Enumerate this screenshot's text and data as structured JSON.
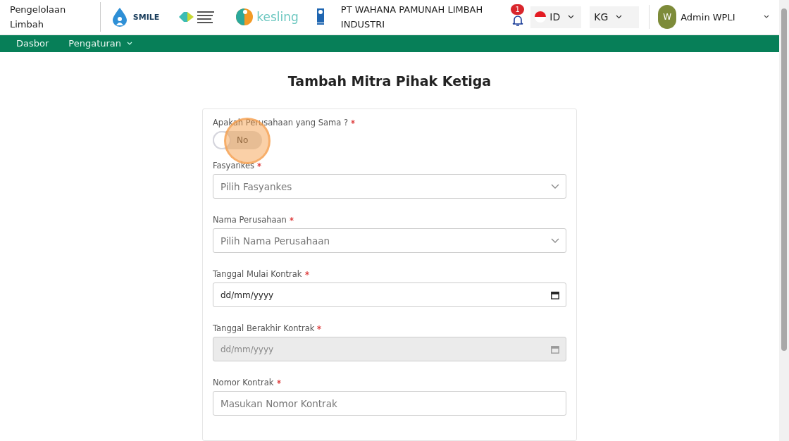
{
  "header": {
    "app_name": "Pengelolaan Limbah",
    "logos": [
      {
        "kind": "smile",
        "text": "SMILE"
      },
      {
        "kind": "kemenkes"
      },
      {
        "kind": "kesling",
        "text": "kesling"
      },
      {
        "kind": "undp"
      }
    ],
    "company": "PT WAHANA PAMUNAH LIMBAH INDUSTRI",
    "notifications": "1",
    "language": "ID",
    "unit": "KG",
    "user": {
      "initial": "W",
      "name": "Admin WPLI"
    }
  },
  "nav": [
    {
      "label": "Dasbor",
      "dropdown": false
    },
    {
      "label": "Pengaturan",
      "dropdown": true
    }
  ],
  "page_title": "Tambah Mitra Pihak Ketiga",
  "toggle": {
    "label": "Apakah Perusahaan yang Sama ?",
    "required": true,
    "on": false,
    "text": "No"
  },
  "fields": [
    {
      "kind": "select",
      "label": "Fasyankes",
      "required": true,
      "placeholder": "Pilih Fasyankes",
      "disabled": false
    },
    {
      "kind": "select",
      "label": "Nama Perusahaan",
      "required": true,
      "placeholder": "Pilih Nama Perusahaan",
      "disabled": false
    },
    {
      "kind": "date",
      "label": "Tanggal Mulai Kontrak",
      "required": true,
      "placeholder": "dd/mm/yyyy",
      "disabled": false
    },
    {
      "kind": "date",
      "label": "Tanggal Berakhir Kontrak",
      "required": true,
      "placeholder": "dd/mm/yyyy",
      "disabled": true
    },
    {
      "kind": "text",
      "label": "Nomor Kontrak",
      "required": true,
      "placeholder": "Masukan Nomor Kontrak",
      "disabled": false
    }
  ]
}
